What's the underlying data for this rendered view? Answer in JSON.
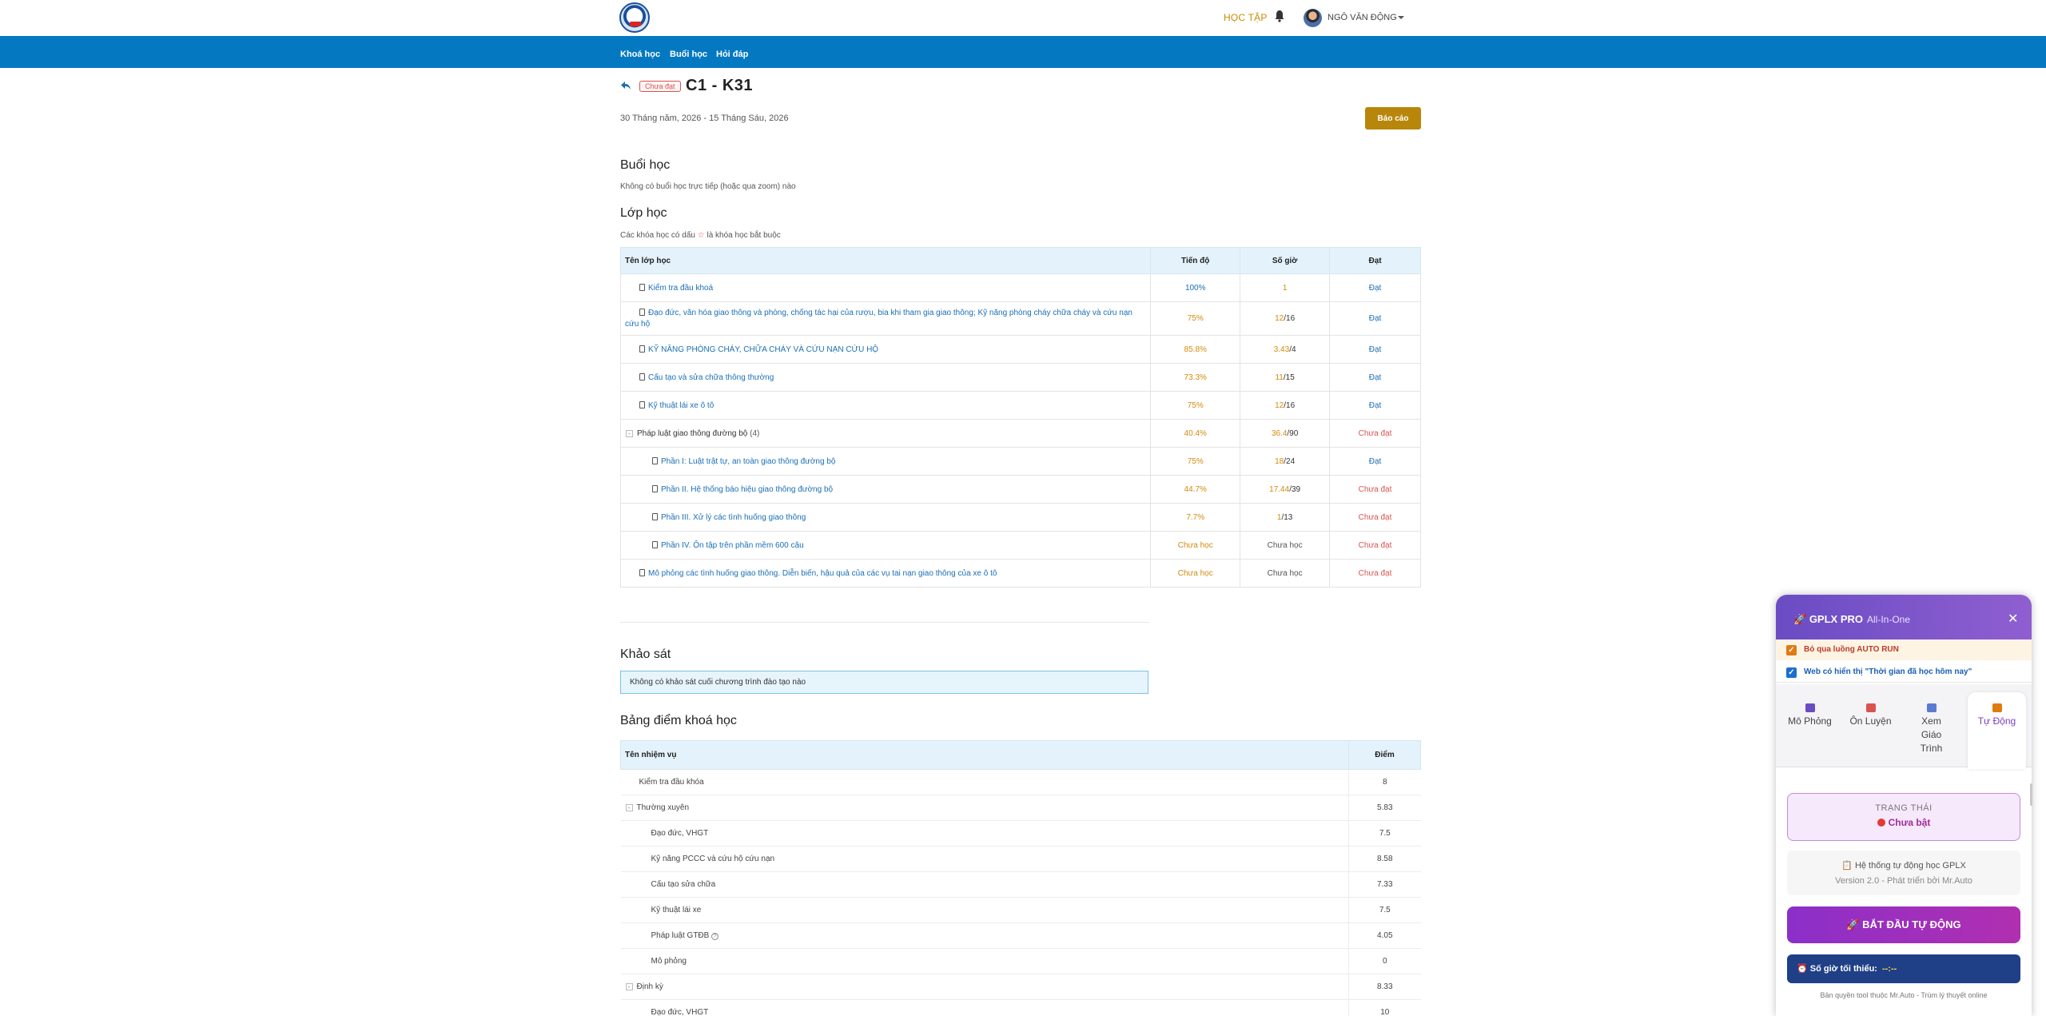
{
  "header": {
    "study_label": "HỌC TẬP",
    "username": "NGÔ VĂN ĐỘNG"
  },
  "nav": [
    "Khoá học",
    "Buổi học",
    "Hỏi đáp"
  ],
  "course": {
    "badge": "Chưa đạt",
    "title": "C1 - K31",
    "date_range": "30 Tháng năm, 2026 - 15 Tháng Sáu, 2026",
    "report_button": "Báo cáo"
  },
  "sessions": {
    "title": "Buổi học",
    "note": "Không có buổi học trực tiếp (hoặc qua zoom) nào"
  },
  "classes": {
    "title": "Lớp học",
    "note_before": "Các khóa học có dấu",
    "note_star": "☆",
    "note_after": "là khóa học bắt buộc",
    "headers": [
      "Tên lớp học",
      "Tiến độ",
      "Số giờ",
      "Đạt"
    ],
    "rows": [
      {
        "name": "Kiểm tra đầu khoá",
        "progress": "100%",
        "hours_done": "1",
        "hours_total": "",
        "pass": "Đạt"
      },
      {
        "name": "Đạo đức, văn hóa giao thông và phòng, chống tác hại của rượu, bia khi tham gia giao thông; Kỹ năng phòng cháy chữa cháy và cứu nạn cứu hộ",
        "progress": "75%",
        "hours_done": "12",
        "hours_total": "/16",
        "pass": "Đạt"
      },
      {
        "name": "KỸ NĂNG PHÒNG CHÁY, CHỮA CHÁY VÀ CỨU NẠN CỨU HỘ",
        "progress": "85.8%",
        "hours_done": "3.43",
        "hours_total": "/4",
        "pass": "Đạt"
      },
      {
        "name": "Cấu tạo và sửa chữa thông thường",
        "progress": "73.3%",
        "hours_done": "11",
        "hours_total": "/15",
        "pass": "Đạt"
      },
      {
        "name": "Kỹ thuật lái xe ô tô",
        "progress": "75%",
        "hours_done": "12",
        "hours_total": "/16",
        "pass": "Đạt"
      },
      {
        "name": "Pháp luật giao thông đường bộ",
        "count": "(4)",
        "progress": "40.4%",
        "hours_done": "36.4",
        "hours_total": "/90",
        "pass": "Chưa đạt"
      },
      {
        "name": "Phần I: Luật trật tự, an toàn giao thông đường bộ",
        "progress": "75%",
        "hours_done": "18",
        "hours_total": "/24",
        "pass": "Đạt"
      },
      {
        "name": "Phần II. Hệ thống báo hiệu giao thông đường bộ",
        "progress": "44.7%",
        "hours_done": "17.44",
        "hours_total": "/39",
        "pass": "Chưa đạt"
      },
      {
        "name": "Phần III. Xử lý các tình huống giao thông",
        "progress": "7.7%",
        "hours_done": "1",
        "hours_total": "/13",
        "pass": "Chưa đạt"
      },
      {
        "name": "Phần IV. Ôn tập trên phần mềm 600 câu",
        "progress": "Chưa học",
        "hours_done": "Chưa học",
        "hours_total": "",
        "pass": "Chưa đạt"
      },
      {
        "name": "Mô phỏng các tình huống giao thông. Diễn biến, hậu quả của các vụ tai nạn giao thông của xe ô tô",
        "progress": "Chưa học",
        "hours_done": "Chưa học",
        "hours_total": "",
        "pass": "Chưa đạt"
      }
    ]
  },
  "survey": {
    "title": "Khảo sát",
    "note": "Không có khảo sát cuối chương trình đào tạo nào"
  },
  "scores": {
    "title": "Bảng điểm khoá học",
    "headers": [
      "Tên nhiệm vụ",
      "Điểm"
    ],
    "rows": [
      {
        "name": "Kiểm tra đầu khóa",
        "score": "8"
      },
      {
        "name": "Thường xuyên",
        "score": "5.83"
      },
      {
        "name": "Đạo đức, VHGT",
        "score": "7.5"
      },
      {
        "name": "Kỹ năng PCCC và cứu hộ cứu nạn",
        "score": "8.58"
      },
      {
        "name": "Cấu tạo sửa chữa",
        "score": "7.33"
      },
      {
        "name": "Kỹ thuật lái xe",
        "score": "7.5"
      },
      {
        "name": "Pháp luật GTĐB",
        "score": "4.05"
      },
      {
        "name": "Mô phỏng",
        "score": "0"
      },
      {
        "name": "Định kỳ",
        "score": "8.33"
      },
      {
        "name": "Đạo đức, VHGT",
        "score": "10"
      }
    ]
  },
  "extension": {
    "title": "GPLX PRO",
    "subtitle": "All-In-One",
    "close": "✕",
    "check1": "Bỏ qua luồng AUTO RUN",
    "check2": "Web có hiển thị \"Thời gian đã học hôm nay\"",
    "tabs": [
      {
        "label": "Mô Phỏng",
        "icon": "simulation-icon",
        "color": "#6a4cc4"
      },
      {
        "label": "Ôn Luyện",
        "icon": "practice-icon",
        "color": "#d9534f"
      },
      {
        "label": "Xem Giáo Trình",
        "icon": "book-icon",
        "color": "#5b7bd1"
      },
      {
        "label": "Tự Động",
        "icon": "rocket-icon",
        "color": "#e07b12"
      }
    ],
    "status_label": "TRẠNG THÁI",
    "status_value": "Chưa bật",
    "info_line1": "📋 Hệ thống tự động học GPLX",
    "info_line2": "Version 2.0 - Phát triển bởi Mr.Auto",
    "start_button": "🚀  BẮT ĐẦU TỰ ĐỘNG",
    "min_hours_label": "⏰ Số giờ tối thiểu:",
    "min_hours_value": "--:--",
    "copyright": "Bản quyền tool thuộc Mr.Auto - Trùm lý thuyết online"
  }
}
